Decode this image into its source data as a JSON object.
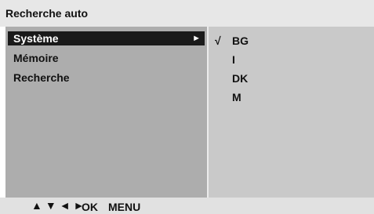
{
  "title": "Recherche auto",
  "menu": {
    "items": [
      {
        "label": "Système",
        "arrow": "►"
      },
      {
        "label": "Mémoire"
      },
      {
        "label": "Recherche"
      }
    ]
  },
  "options": [
    {
      "check": "√",
      "label": "BG"
    },
    {
      "label": "I"
    },
    {
      "label": "DK"
    },
    {
      "label": "M"
    }
  ],
  "footer": {
    "nav_up": "▲",
    "nav_down": "▼",
    "nav_left": "◄",
    "nav_right": "►",
    "ok_label": "OK",
    "menu_label": "MENU"
  },
  "colors": {
    "title_bg": "#e7e7e7",
    "left_panel_bg": "#adadad",
    "right_panel_bg": "#c9c9c9",
    "selection_bg": "#1a1a1a"
  }
}
